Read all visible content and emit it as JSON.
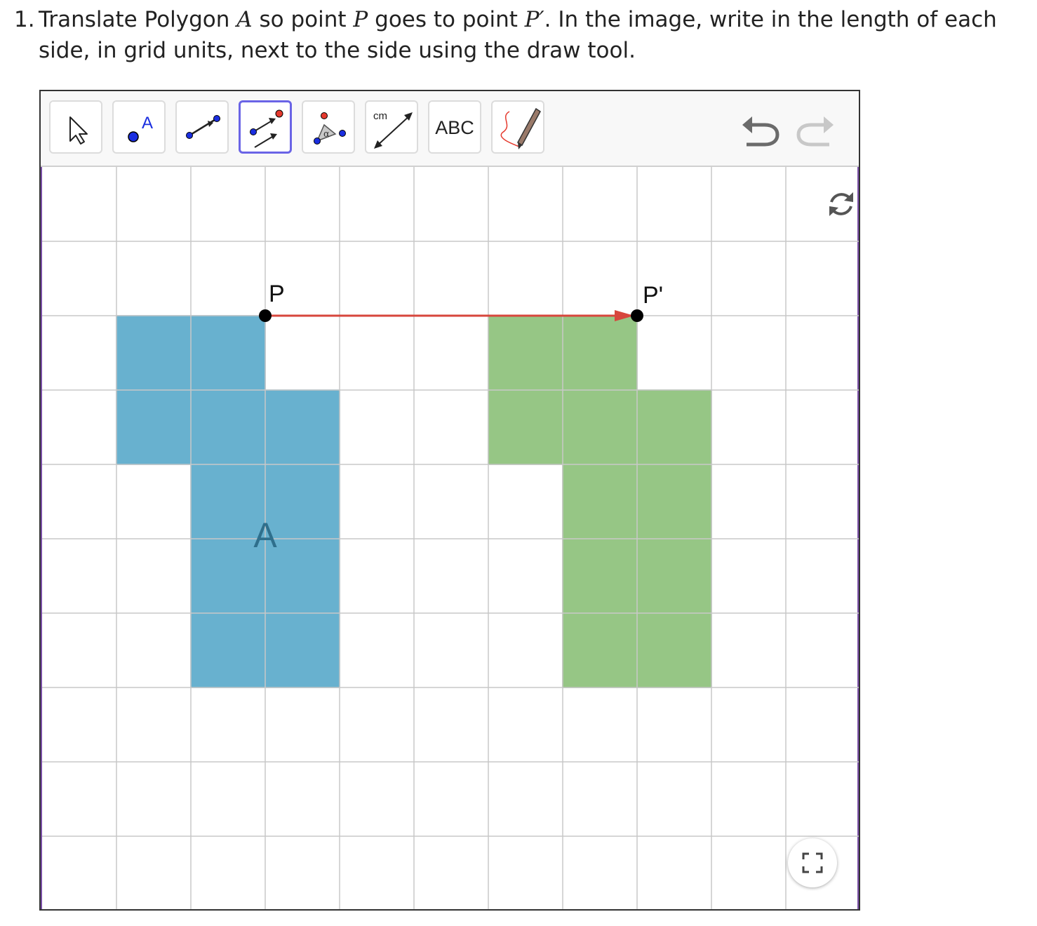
{
  "question": {
    "number": "1.",
    "parts": [
      {
        "t": "Translate Polygon "
      },
      {
        "t": "A",
        "math": true
      },
      {
        "t": " so point "
      },
      {
        "t": "P",
        "math": true
      },
      {
        "t": " goes to point "
      },
      {
        "t": "P′",
        "math": true
      },
      {
        "t": ". In the image, write in the length of each side, in grid units, next to the side using the draw tool."
      }
    ]
  },
  "toolbar": {
    "tools": [
      {
        "name": "move-tool",
        "icon": "cursor-arrow-icon"
      },
      {
        "name": "point-tool",
        "icon": "point-icon",
        "label": "A"
      },
      {
        "name": "segment-tool",
        "icon": "segment-icon"
      },
      {
        "name": "vector-translate-tool",
        "icon": "translate-by-vector-icon",
        "selected": true
      },
      {
        "name": "angle-tool",
        "icon": "angle-icon",
        "label": "α"
      },
      {
        "name": "distance-tool",
        "icon": "distance-icon",
        "label": "cm"
      },
      {
        "name": "text-tool",
        "icon": "text-icon",
        "label": "ABC"
      },
      {
        "name": "pen-tool",
        "icon": "pen-icon"
      }
    ],
    "undo_icon": "undo-icon",
    "redo_icon": "redo-icon"
  },
  "grid": {
    "columns": 11,
    "rows": 10,
    "line_color": "#c8c8c8"
  },
  "colors": {
    "polygon_a_fill": "#68b1cf",
    "polygon_a_stroke": "#4f9cbf",
    "image_fill": "#96c685",
    "image_stroke": "#7db06a",
    "vector": "#d7463c",
    "point": "#000000",
    "selected_tool": "#6a64e6"
  },
  "geometry": {
    "polygon_a": [
      [
        1,
        2
      ],
      [
        3,
        2
      ],
      [
        3,
        3
      ],
      [
        4,
        3
      ],
      [
        4,
        7
      ],
      [
        2,
        7
      ],
      [
        2,
        4
      ],
      [
        1,
        4
      ]
    ],
    "polygon_a_image": [
      [
        6,
        2
      ],
      [
        8,
        2
      ],
      [
        8,
        3
      ],
      [
        9,
        3
      ],
      [
        9,
        7
      ],
      [
        7,
        7
      ],
      [
        7,
        4
      ],
      [
        6,
        4
      ]
    ],
    "point_p": [
      3,
      2
    ],
    "point_p_prime": [
      8,
      2
    ]
  },
  "labels": {
    "polygon": "A",
    "p": "P",
    "p_prime": "P'"
  },
  "controls": {
    "refresh_icon": "refresh-icon",
    "fullscreen_icon": "fullscreen-icon"
  }
}
